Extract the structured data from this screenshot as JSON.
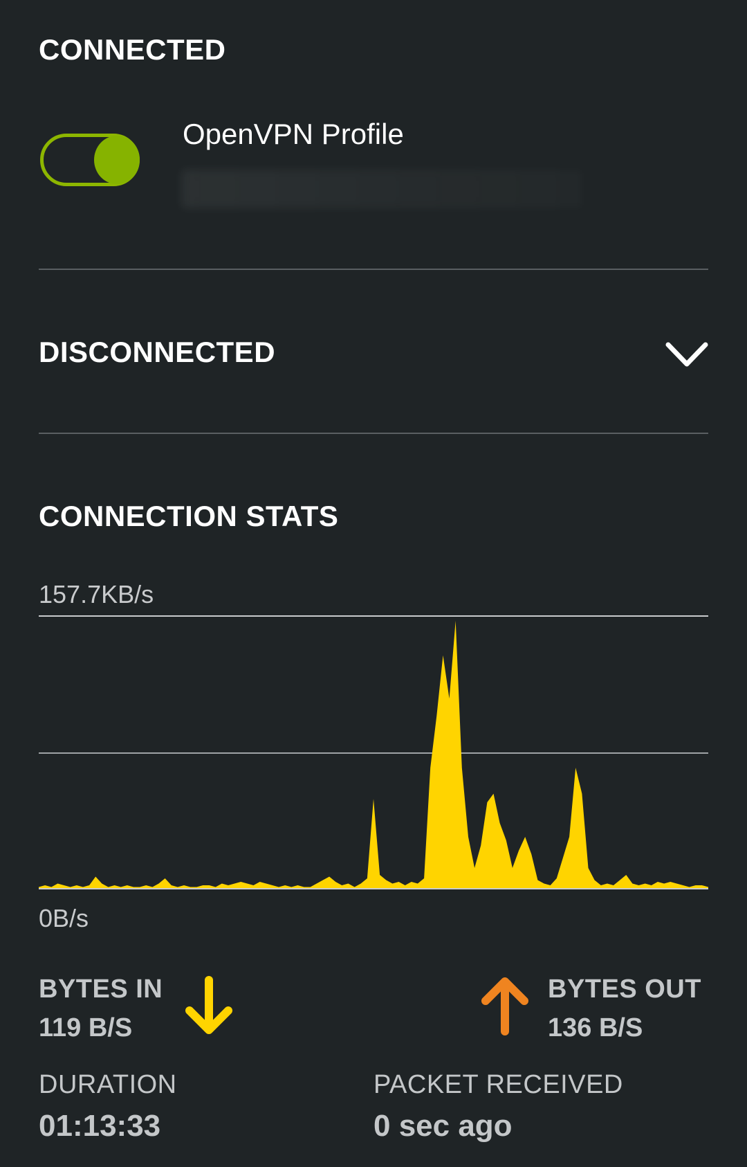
{
  "sections": {
    "connected_title": "CONNECTED",
    "disconnected_title": "DISCONNECTED",
    "stats_title": "CONNECTION STATS"
  },
  "profile": {
    "name": "OpenVPN Profile",
    "toggle_on": true
  },
  "colors": {
    "background": "#1f2426",
    "toggle_accent": "#86b300",
    "bytes_in": "#ffd400",
    "bytes_out": "#ef8420"
  },
  "chart": {
    "max_label": "157.7KB/s",
    "min_label": "0B/s"
  },
  "chart_data": {
    "type": "area",
    "ymax_label": "157.7KB/s",
    "ymin_label": "0B/s",
    "ylim": [
      0,
      157.7
    ],
    "unit": "KB/s",
    "series": [
      {
        "values": [
          1,
          2,
          1,
          3,
          2,
          1,
          2,
          1,
          2,
          7,
          3,
          1,
          2,
          1,
          2,
          1,
          1,
          2,
          1,
          3,
          6,
          2,
          1,
          2,
          1,
          1,
          2,
          2,
          1,
          3,
          2,
          3,
          4,
          3,
          2,
          4,
          3,
          2,
          1,
          2,
          1,
          2,
          1,
          1,
          3,
          5,
          7,
          4,
          2,
          3,
          1,
          3,
          6,
          52,
          8,
          5,
          3,
          4,
          2,
          4,
          3,
          6,
          70,
          100,
          135,
          110,
          155,
          70,
          30,
          12,
          25,
          50,
          55,
          38,
          28,
          12,
          22,
          30,
          20,
          5,
          3,
          2,
          6,
          18,
          30,
          70,
          55,
          12,
          5,
          2,
          3,
          2,
          5,
          8,
          3,
          2,
          3,
          2,
          4,
          3,
          4,
          3,
          2,
          1,
          2,
          2,
          1
        ]
      },
      {
        "values": [
          0,
          1,
          0,
          1,
          1,
          0,
          1,
          0,
          1,
          2,
          1,
          0,
          1,
          0,
          1,
          0,
          0,
          1,
          0,
          1,
          2,
          1,
          0,
          1,
          0,
          0,
          1,
          1,
          0,
          2,
          1,
          2,
          3,
          2,
          1,
          3,
          2,
          1,
          0,
          1,
          0,
          1,
          0,
          0,
          2,
          4,
          6,
          3,
          1,
          2,
          0,
          1,
          2,
          3,
          2,
          1,
          1,
          1,
          1,
          1,
          1,
          1,
          1,
          1,
          1,
          1,
          1,
          1,
          1,
          1,
          1,
          1,
          1,
          1,
          1,
          1,
          1,
          1,
          1,
          1,
          1,
          1,
          1,
          1,
          1,
          1,
          1,
          1,
          1,
          1,
          2,
          1,
          3,
          4,
          2,
          1,
          2,
          1,
          3,
          2,
          3,
          2,
          1,
          0,
          1,
          1,
          0
        ]
      }
    ],
    "grid": true,
    "gridlines": 3
  },
  "stats": {
    "bytes_in_label": "BYTES IN",
    "bytes_in_value": "119 B/S",
    "bytes_out_label": "BYTES OUT",
    "bytes_out_value": "136 B/S",
    "duration_label": "DURATION",
    "duration_value": "01:13:33",
    "packet_label": "PACKET RECEIVED",
    "packet_value": "0 sec ago"
  }
}
